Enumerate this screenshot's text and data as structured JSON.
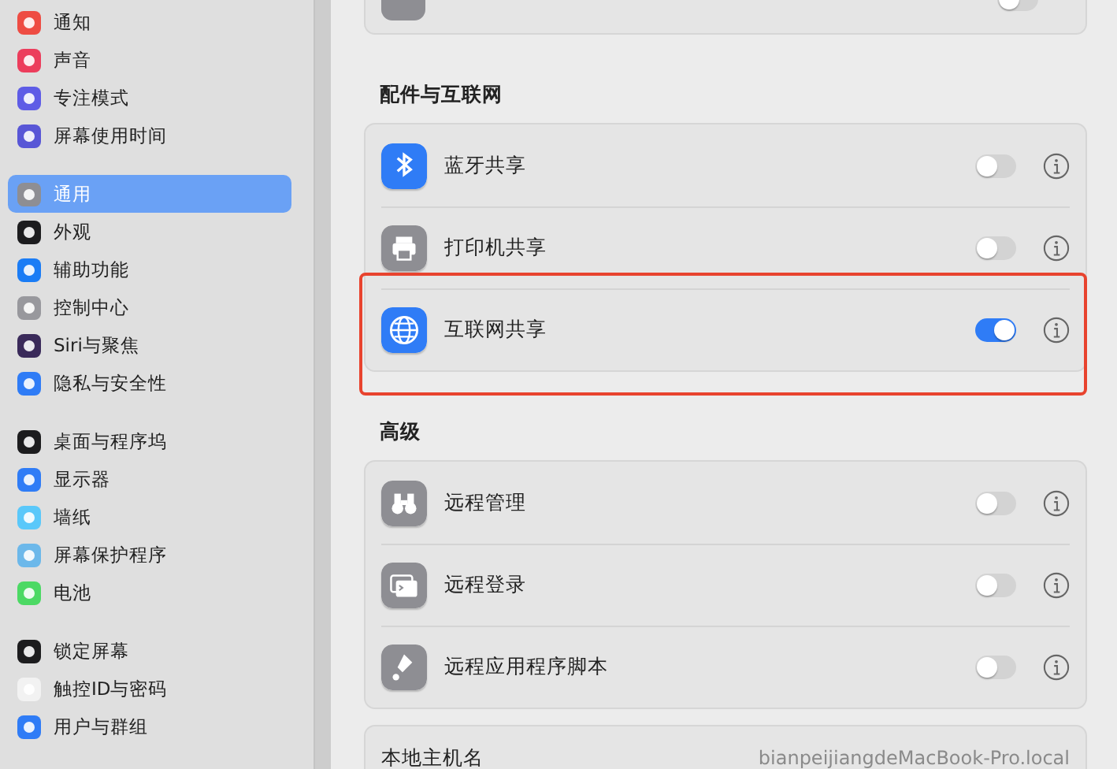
{
  "sidebar": {
    "groups": [
      {
        "items": [
          {
            "label": "通知",
            "color": "#ee4c43",
            "selected": false
          },
          {
            "label": "声音",
            "color": "#ec3d5c",
            "selected": false
          },
          {
            "label": "专注模式",
            "color": "#5e5ce6",
            "selected": false
          },
          {
            "label": "屏幕使用时间",
            "color": "#5856d6",
            "selected": false
          }
        ]
      },
      {
        "items": [
          {
            "label": "通用",
            "color": "#8e8e93",
            "selected": true
          },
          {
            "label": "外观",
            "color": "#1c1c1e",
            "selected": false
          },
          {
            "label": "辅助功能",
            "color": "#1a7cf5",
            "selected": false
          },
          {
            "label": "控制中心",
            "color": "#98989d",
            "selected": false
          },
          {
            "label": "Siri与聚焦",
            "color": "#3a2a5a",
            "selected": false
          },
          {
            "label": "隐私与安全性",
            "color": "#2f7cf6",
            "selected": false
          }
        ]
      },
      {
        "items": [
          {
            "label": "桌面与程序坞",
            "color": "#1c1c1e",
            "selected": false
          },
          {
            "label": "显示器",
            "color": "#2f7cf6",
            "selected": false
          },
          {
            "label": "墙纸",
            "color": "#5ac8fa",
            "selected": false
          },
          {
            "label": "屏幕保护程序",
            "color": "#6cb8ea",
            "selected": false
          },
          {
            "label": "电池",
            "color": "#4cd964",
            "selected": false
          }
        ]
      },
      {
        "items": [
          {
            "label": "锁定屏幕",
            "color": "#1c1c1e",
            "selected": false
          },
          {
            "label": "触控ID与密码",
            "color": "#f2f2f2",
            "selected": false
          },
          {
            "label": "用户与群组",
            "color": "#2f7cf6",
            "selected": false
          }
        ]
      }
    ]
  },
  "top_card": {
    "on": false
  },
  "sections": [
    {
      "heading": "配件与互联网",
      "rows": [
        {
          "label": "蓝牙共享",
          "on": false,
          "highlighted": false
        },
        {
          "label": "打印机共享",
          "on": false,
          "highlighted": false
        },
        {
          "label": "互联网共享",
          "on": true,
          "highlighted": true
        }
      ]
    },
    {
      "heading": "高级",
      "rows": [
        {
          "label": "远程管理",
          "on": false,
          "highlighted": false
        },
        {
          "label": "远程登录",
          "on": false,
          "highlighted": false
        },
        {
          "label": "远程应用程序脚本",
          "on": false,
          "highlighted": false
        }
      ]
    }
  ],
  "hostname": {
    "label": "本地主机名",
    "value": "bianpeijiangdeMacBook-Pro.local"
  }
}
